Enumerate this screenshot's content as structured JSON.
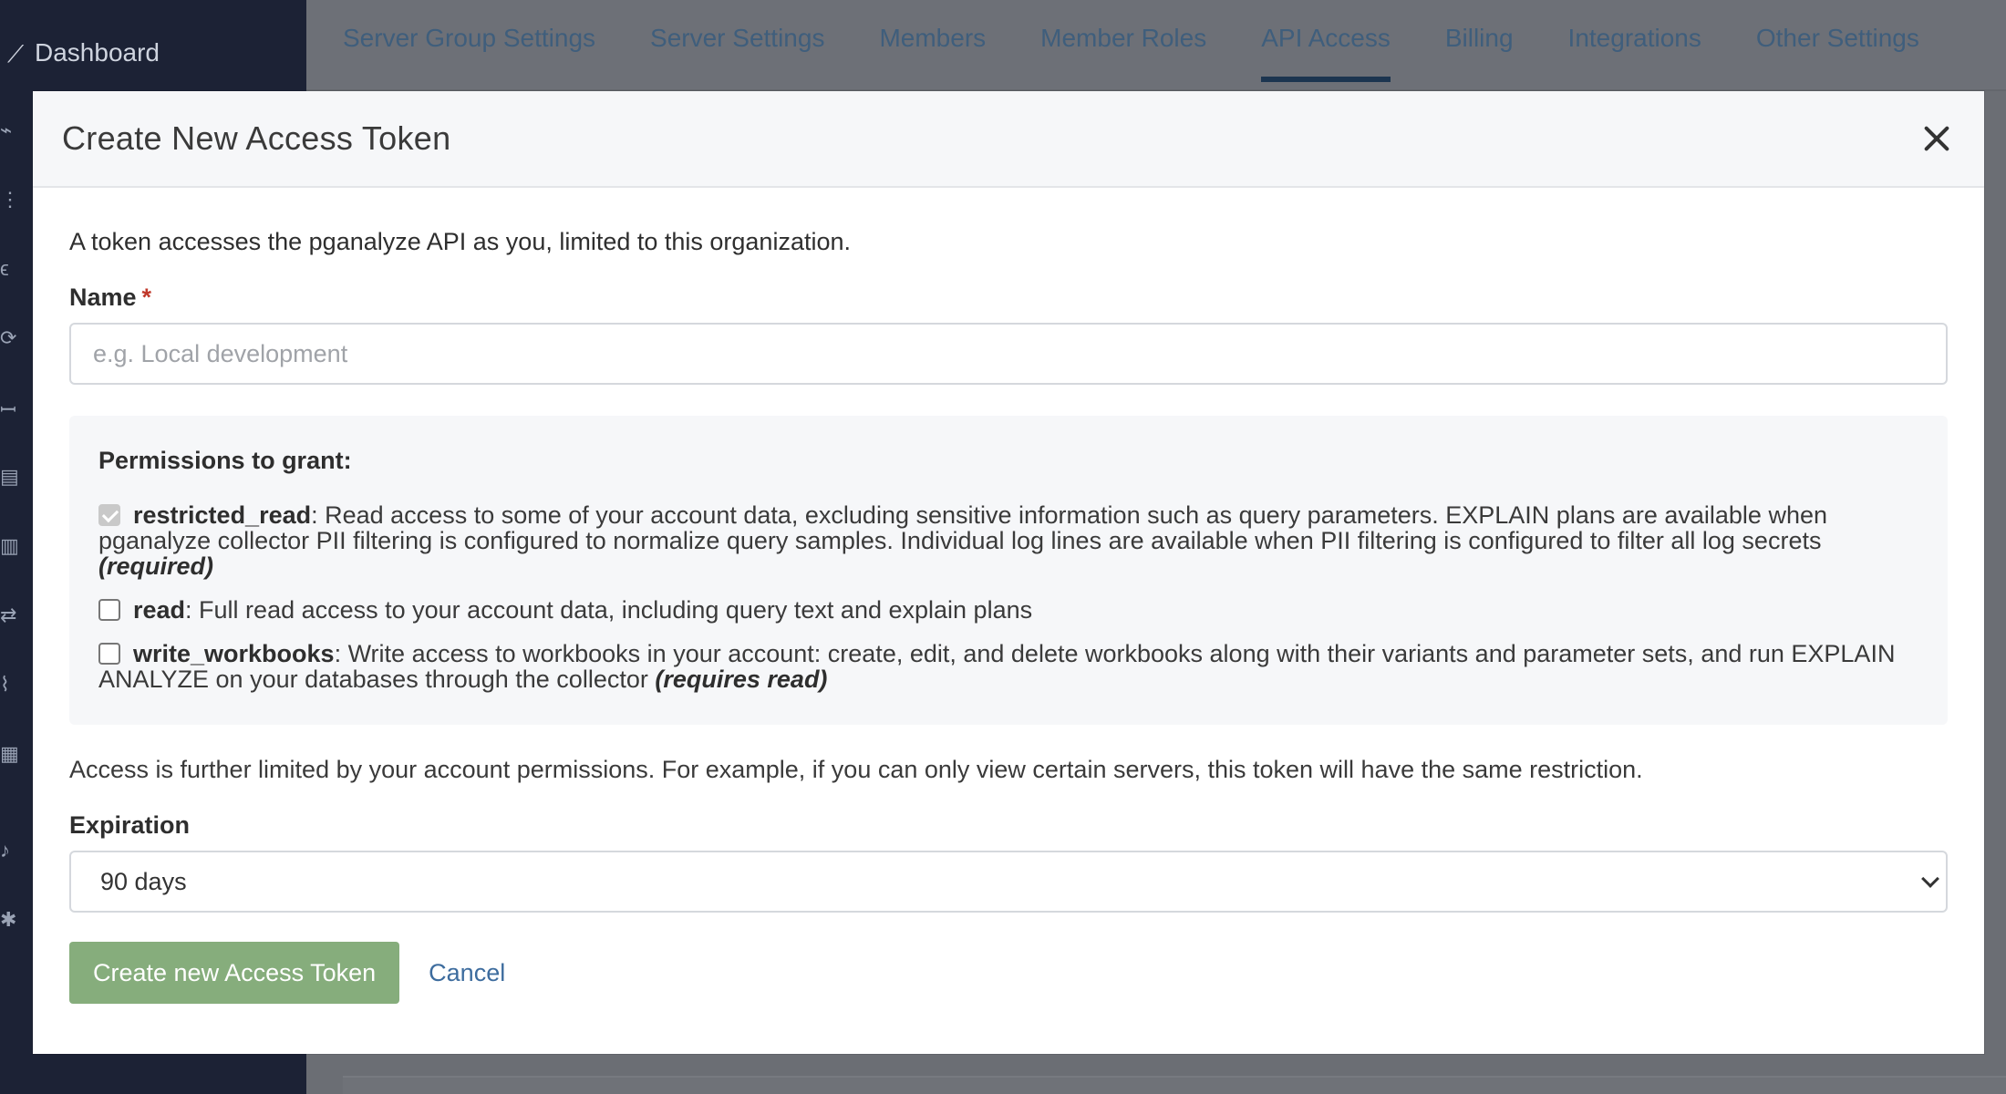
{
  "sidebar": {
    "dashboard_label": "Dashboard"
  },
  "tabs": [
    {
      "label": "Server Group Settings",
      "active": false
    },
    {
      "label": "Server Settings",
      "active": false
    },
    {
      "label": "Members",
      "active": false
    },
    {
      "label": "Member Roles",
      "active": false
    },
    {
      "label": "API Access",
      "active": true
    },
    {
      "label": "Billing",
      "active": false
    },
    {
      "label": "Integrations",
      "active": false
    },
    {
      "label": "Other Settings",
      "active": false
    }
  ],
  "modal": {
    "title": "Create New Access Token",
    "intro": "A token accesses the pganalyze API as you, limited to this organization.",
    "name_label": "Name",
    "required_marker": "*",
    "name_placeholder": "e.g. Local development",
    "name_value": "",
    "permissions_heading": "Permissions to grant:",
    "permissions": [
      {
        "name": "restricted_read",
        "checked": true,
        "disabled": true,
        "description": ": Read access to some of your account data, excluding sensitive information such as query parameters. EXPLAIN plans are available when pganalyze collector PII filtering is configured to normalize query samples. Individual log lines are available when PII filtering is configured to filter all log secrets ",
        "note": "(required)"
      },
      {
        "name": "read",
        "checked": false,
        "disabled": false,
        "description": ": Full read access to your account data, including query text and explain plans",
        "note": ""
      },
      {
        "name": "write_workbooks",
        "checked": false,
        "disabled": false,
        "description": ": Write access to workbooks in your account: create, edit, and delete workbooks along with their variants and parameter sets, and run EXPLAIN ANALYZE on your databases through the collector ",
        "note": "(requires read)"
      }
    ],
    "limit_text": "Access is further limited by your account permissions. For example, if you can only view certain servers, this token will have the same restriction.",
    "expiration_label": "Expiration",
    "expiration_value": "90 days",
    "create_button": "Create new Access Token",
    "cancel_link": "Cancel"
  },
  "colors": {
    "sidebar_bg": "#1c2235",
    "primary_button": "#86ad7c",
    "link": "#3d6c9e",
    "required": "#c0392b"
  }
}
